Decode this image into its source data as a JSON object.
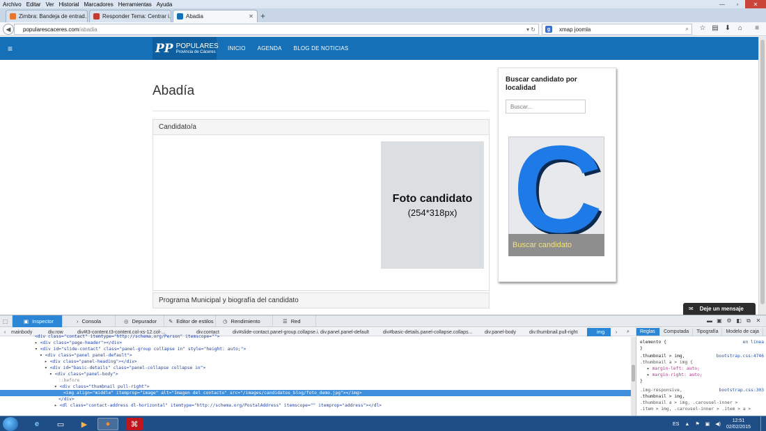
{
  "menubar": [
    "Archivo",
    "Editar",
    "Ver",
    "Historial",
    "Marcadores",
    "Herramientas",
    "Ayuda"
  ],
  "tabs": [
    {
      "label": "Zimbra: Bandeja de entrad...",
      "active": false
    },
    {
      "label": "Responder Tema: Centrar i...",
      "active": false
    },
    {
      "label": "Abadia",
      "active": true
    }
  ],
  "address": {
    "host": "popularescaceres.com",
    "path": "/abadia"
  },
  "search": {
    "value": "xmap joomla"
  },
  "site": {
    "logo_mark": "PP",
    "logo_line1": "POPULARES",
    "logo_line2": "Provincia de Cáceres",
    "nav": [
      "INICIO",
      "AGENDA",
      "BLOG DE NOTICIAS"
    ]
  },
  "content": {
    "title": "Abadía",
    "panel_heading": "Candidato/a",
    "photo_title": "Foto candidato",
    "photo_size": "(254*318px)",
    "panel2_heading": "Programa Municipal y biografía del candidato"
  },
  "sidebar": {
    "heading": "Buscar candidato por localidad",
    "search_placeholder": "Buscar...",
    "image_letter": "C",
    "image_button": "Buscar candidato"
  },
  "chat": {
    "label": "Deje un mensaje"
  },
  "devtools": {
    "tabs": [
      "Inspector",
      "Consola",
      "Depurador",
      "Editor de estilos",
      "Rendimiento",
      "Red"
    ],
    "breadcrumbs": [
      "mainbody",
      "div.row",
      "div#t3-content.t3-content.col-xs-12.col-...",
      "div.contact",
      "div#slide-contact.panel-group.collapse.i...",
      "div.panel.panel-default",
      "div#basic-details.panel-collapse.collaps...",
      "div.panel-body",
      "div.thumbnail.pull-right",
      "img"
    ],
    "rule_tabs": [
      "Reglas",
      "Computada",
      "Tipografía",
      "Modelo de caja"
    ],
    "rules": {
      "element_selector": "elemento {",
      "element_src": "en línea",
      "close_brace": "}",
      "r1_sel1": ".thumbnail > img,",
      "r1_src": "bootstrap.css:4746",
      "r1_sel2": ".thumbnail a > img {",
      "r1_p1": "margin-left: auto;",
      "r1_p2": "margin-right: auto;",
      "r2_sel1": ".img-responsive,",
      "r2_src": "bootstrap.css:303",
      "r2_sel2": ".thumbnail > img,",
      "r2_sel3": ".thumbnail a > img, .carousel-inner >",
      "r2_sel4": ".item > img, .carousel-inner > .item > a >"
    },
    "markup": {
      "l0": "<div class=\"contact\" itemtype=\"http://schema.org/Person\" itemscope=\"\">",
      "l1": "<div class=\"page-header\"></div>",
      "l2": "<div id=\"slide-contact\" class=\"panel-group collapse in\" style=\"height: auto;\">",
      "l3": "<div class=\"panel panel-default\">",
      "l4": "<div class=\"panel-heading\"></div>",
      "l5": "<div id=\"basic-details\" class=\"panel-collapse collapse in\">",
      "l6": "<div class=\"panel-body\">",
      "l7": "::before",
      "l8": "<div class=\"thumbnail pull-right\">",
      "l9": "<img align=\"middle\" itemprop=\"image\" alt=\"Imagen del contacto\" src=\"/images/candidatos_blog/foto_demo.jpg\"></img>",
      "l10": "</div>",
      "l11": "<dl class=\"contact-address dl-horizontal\" itemtype=\"http://schema.org/PostalAddress\" itemscope=\"\" itemprop=\"address\"></dl>"
    }
  },
  "taskbar": {
    "lang": "ES",
    "time": "12:51",
    "date": "02/02/2015"
  },
  "colors": {
    "header_blue": "#1570b7",
    "devtools_active": "#2b86d6",
    "candidate_blue": "#1e7ae6",
    "button_text": "#f1e27a"
  }
}
